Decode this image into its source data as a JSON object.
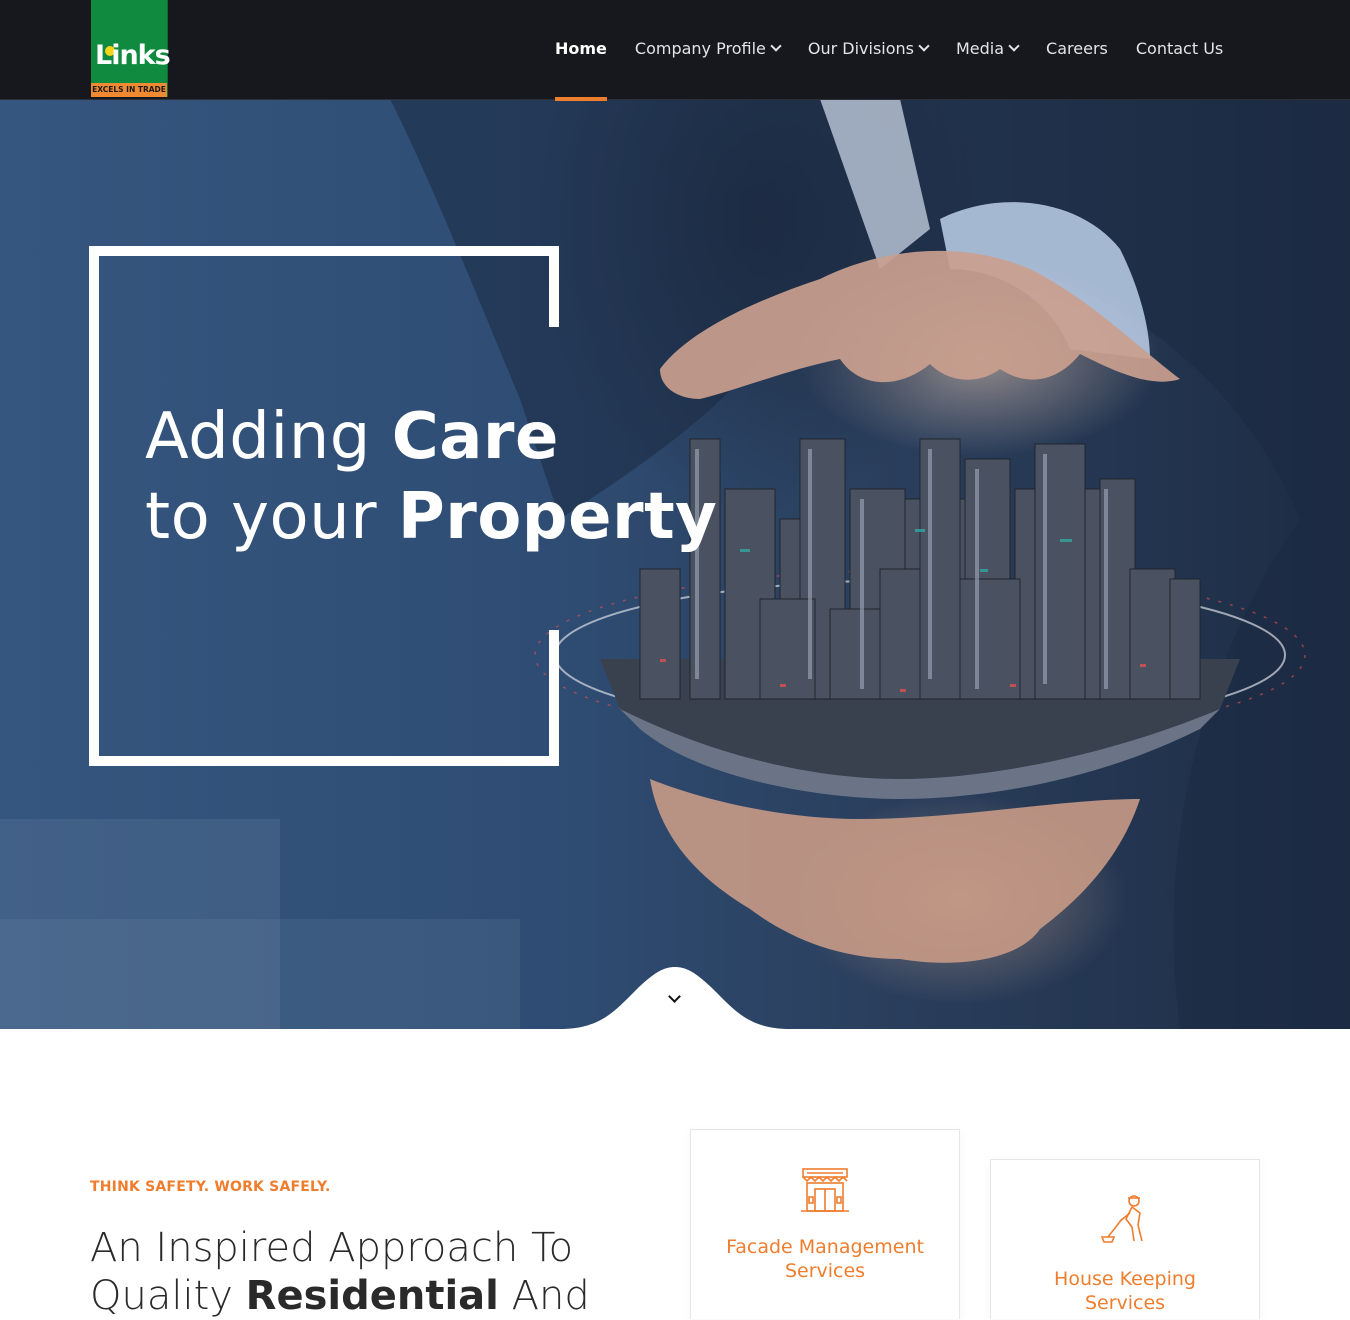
{
  "brand": {
    "logo_word": "Links",
    "logo_tagline": "EXCELS IN TRADE",
    "colors": {
      "accent": "#ef7d2e",
      "logo_green": "#0f8a3f",
      "header_bg": "#16181d"
    }
  },
  "nav": {
    "items": [
      {
        "label": "Home",
        "active": true,
        "has_dropdown": false
      },
      {
        "label": "Company Profile",
        "active": false,
        "has_dropdown": true
      },
      {
        "label": "Our Divisions",
        "active": false,
        "has_dropdown": true
      },
      {
        "label": "Media",
        "active": false,
        "has_dropdown": true
      },
      {
        "label": "Careers",
        "active": false,
        "has_dropdown": false
      },
      {
        "label": "Contact Us",
        "active": false,
        "has_dropdown": false
      }
    ]
  },
  "hero": {
    "line1_regular": "Adding ",
    "line1_bold": "Care",
    "line2_regular": "to your ",
    "line2_bold": "Property",
    "scroll_icon": "chevron-down-icon"
  },
  "intro": {
    "tagline": "THINK SAFETY. WORK SAFELY.",
    "heading_part1": "An Inspired Approach To",
    "heading_part2": "Quality ",
    "heading_bold": "Residential",
    "heading_part3": " And"
  },
  "services": [
    {
      "title": "Facade Management Services",
      "icon": "storefront-icon"
    },
    {
      "title": "House Keeping Services",
      "icon": "cleaner-icon"
    }
  ]
}
